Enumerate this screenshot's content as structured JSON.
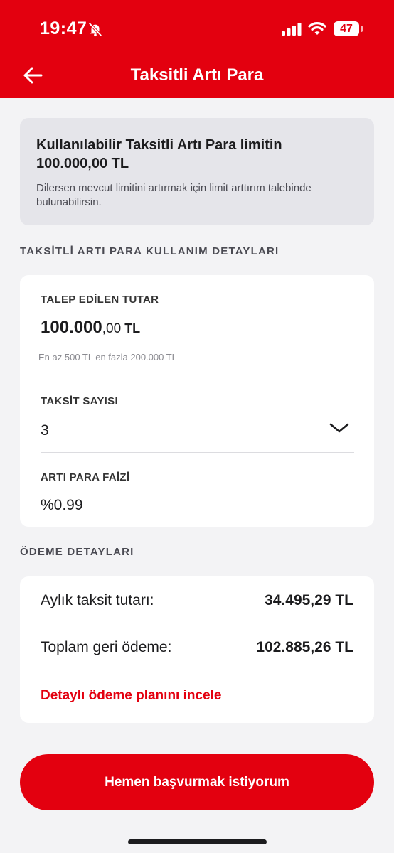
{
  "status_bar": {
    "time": "19:47",
    "battery": "47"
  },
  "header": {
    "title": "Taksitli Artı Para"
  },
  "info_card": {
    "title": "Kullanılabilir Taksitli Artı Para limitin 100.000,00  TL",
    "subtitle": "Dilersen mevcut limitini artırmak için limit arttırım talebinde bulunabilirsin."
  },
  "usage_section": {
    "label": "TAKSİTLİ ARTI PARA KULLANIM DETAYLARI",
    "requested_amount": {
      "label": "TALEP EDİLEN TUTAR",
      "integer": "100.000",
      "decimal": ",00",
      "currency": " TL",
      "hint": "En az 500 TL en fazla 200.000 TL"
    },
    "installments": {
      "label": "TAKSİT SAYISI",
      "value": "3"
    },
    "interest": {
      "label": "ARTI PARA FAİZİ",
      "value": "%0.99"
    }
  },
  "payment_section": {
    "label": "ÖDEME DETAYLARI",
    "monthly": {
      "label": "Aylık taksit tutarı:",
      "value": "34.495,29 TL"
    },
    "total": {
      "label": "Toplam geri ödeme:",
      "value": "102.885,26 TL"
    },
    "link": "Detaylı ödeme planını incele"
  },
  "apply_button": "Hemen başvurmak istiyorum",
  "colors": {
    "brand": "#e3000f",
    "background": "#f3f3f5",
    "card": "#ffffff",
    "info_card": "#e5e5ea"
  },
  "icons": [
    "bell-slash-icon",
    "signal-icon",
    "wifi-icon",
    "battery-icon",
    "back-arrow-icon",
    "chevron-down-icon"
  ]
}
